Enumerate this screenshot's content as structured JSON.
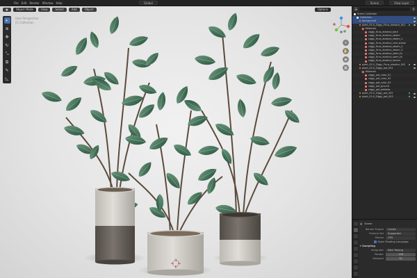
{
  "topbar": {
    "menu": [
      "File",
      "Edit",
      "Render",
      "Window",
      "Help"
    ],
    "orientation": "Global",
    "scene_name": "Scene",
    "view_layer": "View Layer"
  },
  "viewport": {
    "mode": "Object Mode",
    "menus": [
      "View",
      "Select",
      "Add",
      "Object"
    ],
    "options_label": "Options",
    "info_lines": [
      "User Perspective",
      "(1) Collection"
    ],
    "tools": [
      "cursor",
      "move",
      "rotate",
      "scale",
      "transform",
      "annotate",
      "measure"
    ]
  },
  "outliner": {
    "header_label": "Scene Collection",
    "rows": [
      {
        "label": "Scene Collection",
        "icon": "collection-icon",
        "indent": 0
      },
      {
        "label": "Collection",
        "icon": "collection-icon",
        "indent": 1,
        "selected": true
      },
      {
        "label": "background",
        "icon": "object-icon",
        "indent": 2,
        "selected": true
      },
      {
        "label": "plant_05.0_Ziggy_Ficus_elastica_001",
        "icon": "object-icon",
        "indent": 2,
        "modifier": true
      },
      {
        "label": "Materials",
        "icon": "mesh-icon",
        "indent": 3
      },
      {
        "label": "ziggy_ficus_elastica_bark",
        "icon": "material-icon",
        "indent": 4
      },
      {
        "label": "ziggy_ficus_elastica_steam",
        "icon": "material-icon",
        "indent": 4
      },
      {
        "label": "ziggy_ficus_elastica_steam_1",
        "icon": "material-icon",
        "indent": 4
      },
      {
        "label": "ziggy_ficus_elastica_root_steam",
        "icon": "material-icon",
        "indent": 4
      },
      {
        "label": "ziggy_ficus_elastica_steam_2",
        "icon": "material-icon",
        "indent": 4
      },
      {
        "label": "ziggy_ficus_elastica_steam_3",
        "icon": "material-icon",
        "indent": 4
      },
      {
        "label": "ziggy_ficus_elastica_stem_ta",
        "icon": "material-icon",
        "indent": 4
      },
      {
        "label": "ziggy_ficus_elastica_stem_tb",
        "icon": "material-icon",
        "indent": 4
      },
      {
        "label": "ziggy_ficus_elastica_leaves",
        "icon": "material-icon",
        "indent": 4
      },
      {
        "label": "plant_05.0_Ziggy_Ficus_elastica_002",
        "icon": "object-icon",
        "indent": 2,
        "modifier": true
      },
      {
        "label": "plant_05.0_Ziggy_pot_001",
        "icon": "object-icon",
        "indent": 2
      },
      {
        "label": "Materials",
        "icon": "mesh-icon",
        "indent": 3
      },
      {
        "label": "ziggy_pot_color_01",
        "icon": "material-icon",
        "indent": 4
      },
      {
        "label": "ziggy_pot_color_02",
        "icon": "material-icon",
        "indent": 4
      },
      {
        "label": "ziggy_pot_color_03",
        "icon": "material-icon",
        "indent": 4
      },
      {
        "label": "ziggy_pot_ground",
        "icon": "material-icon",
        "indent": 4
      },
      {
        "label": "ziggy_pot_pebbles",
        "icon": "material-icon",
        "indent": 4
      },
      {
        "label": "plant_05.0_Ziggy_pot_002",
        "icon": "object-icon",
        "indent": 2,
        "modifier": true
      },
      {
        "label": "plant_05.0_Ziggy_pot_003",
        "icon": "object-icon",
        "indent": 2,
        "modifier": true
      }
    ]
  },
  "properties": {
    "context": "Scene",
    "section_render": "Scene",
    "fields": [
      {
        "label": "Render Engine",
        "value": "Cycles"
      },
      {
        "label": "Feature Set",
        "value": "Supported"
      },
      {
        "label": "Device",
        "value": "CPU"
      }
    ],
    "checkbox_label": "Open Shading Language",
    "section_sampling": "Sampling",
    "integrator_label": "Integrator",
    "integrator_value": "Path Tracing",
    "render_label": "Render",
    "render_value": "128",
    "viewport_label": "Viewport",
    "viewport_value": "32"
  },
  "colors": {
    "accent": "#4772b3",
    "panel": "#282828",
    "leaf_dark": "#2f5a44",
    "leaf_light": "#5e8f73",
    "pot_top": "#d3d0cb",
    "pot_bottom": "#6b6560"
  }
}
